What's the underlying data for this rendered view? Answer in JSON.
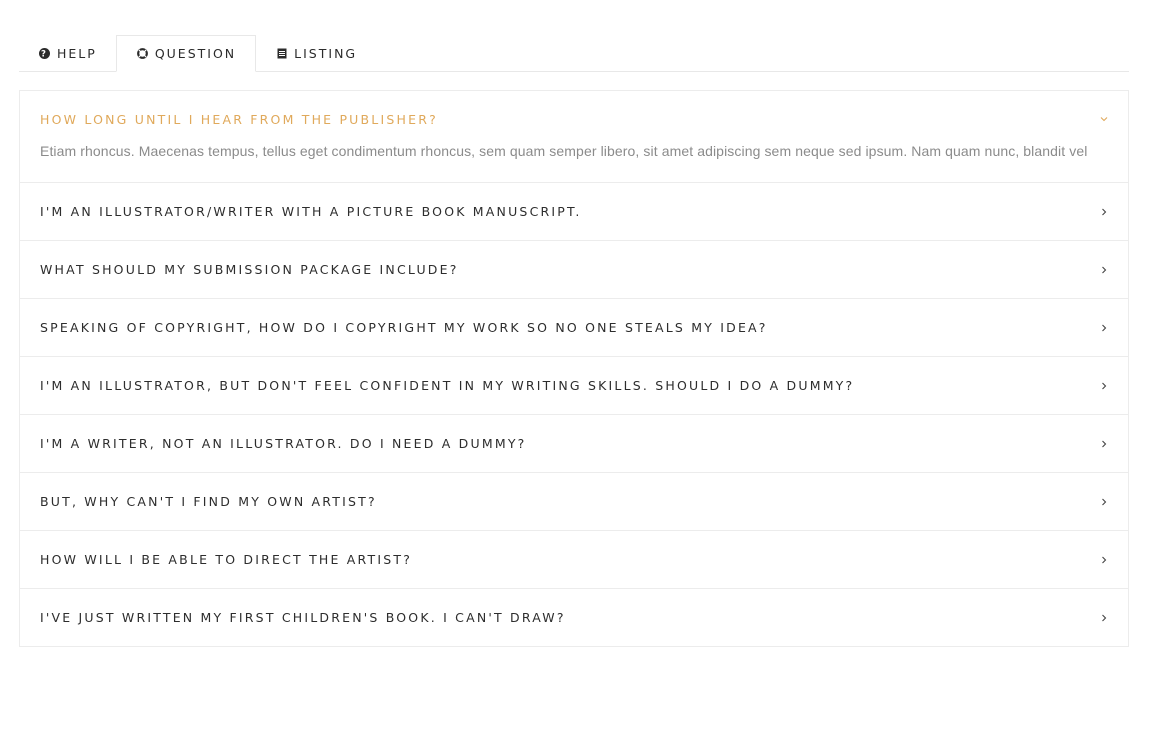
{
  "tabs": [
    {
      "label": "HELP",
      "icon": "question-circle-icon",
      "active": false
    },
    {
      "label": "QUESTION",
      "icon": "lifebuoy-icon",
      "active": true
    },
    {
      "label": "LISTING",
      "icon": "list-icon",
      "active": false
    }
  ],
  "accordion": {
    "accent_color": "#e0a95b",
    "items": [
      {
        "title": "HOW LONG UNTIL I HEAR FROM THE PUBLISHER?",
        "open": true,
        "body": "Etiam rhoncus. Maecenas tempus, tellus eget condimentum rhoncus, sem quam semper libero, sit amet adipiscing sem neque sed ipsum. Nam quam nunc, blandit vel"
      },
      {
        "title": "I'M AN ILLUSTRATOR/WRITER WITH A PICTURE BOOK MANUSCRIPT.",
        "open": false
      },
      {
        "title": "WHAT SHOULD MY SUBMISSION PACKAGE INCLUDE?",
        "open": false
      },
      {
        "title": "SPEAKING OF COPYRIGHT, HOW DO I COPYRIGHT MY WORK SO NO ONE STEALS MY IDEA?",
        "open": false
      },
      {
        "title": "I'M AN ILLUSTRATOR, BUT DON'T FEEL CONFIDENT IN MY WRITING SKILLS. SHOULD I DO A DUMMY?",
        "open": false
      },
      {
        "title": "I'M A WRITER, NOT AN ILLUSTRATOR. DO I NEED A DUMMY?",
        "open": false
      },
      {
        "title": "BUT, WHY CAN'T I FIND MY OWN ARTIST?",
        "open": false
      },
      {
        "title": "HOW WILL I BE ABLE TO DIRECT THE ARTIST?",
        "open": false
      },
      {
        "title": "I'VE JUST WRITTEN MY FIRST CHILDREN'S BOOK. I CAN'T DRAW?",
        "open": false
      }
    ]
  }
}
